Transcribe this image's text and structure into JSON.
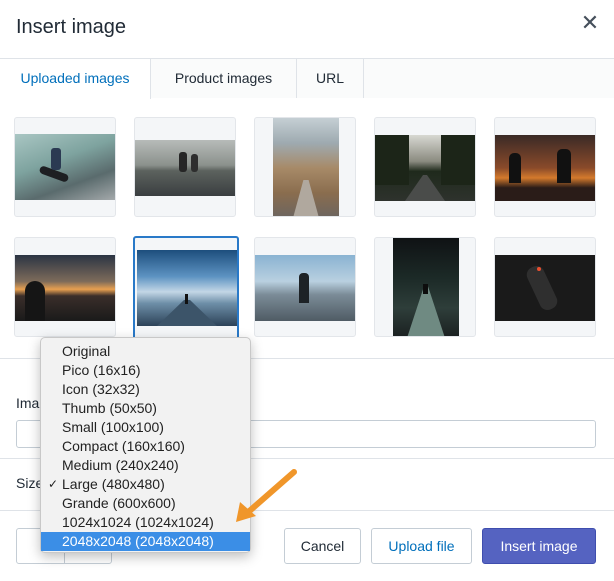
{
  "modal": {
    "title": "Insert image",
    "close_glyph": "✕"
  },
  "tabs": [
    {
      "label": "Uploaded images",
      "active": true
    },
    {
      "label": "Product images",
      "active": false
    },
    {
      "label": "URL",
      "active": false
    }
  ],
  "thumbnails": [
    {
      "subject": "skateboarder jumping",
      "selected": false
    },
    {
      "subject": "riders on road",
      "selected": false
    },
    {
      "subject": "mountain road",
      "selected": false
    },
    {
      "subject": "skater on forest road",
      "selected": false
    },
    {
      "subject": "silhouettes at sunset",
      "selected": false
    },
    {
      "subject": "skater under sunset sky",
      "selected": false
    },
    {
      "subject": "pier under cloudy sky",
      "selected": true
    },
    {
      "subject": "person facing mountains",
      "selected": false
    },
    {
      "subject": "night bridge",
      "selected": false
    },
    {
      "subject": "longboard on dark ground",
      "selected": false
    }
  ],
  "form": {
    "alt_label": "Imag",
    "size_label": "Size"
  },
  "size_options": [
    {
      "label": "Original",
      "checked": false,
      "highlighted": false
    },
    {
      "label": "Pico (16x16)",
      "checked": false,
      "highlighted": false
    },
    {
      "label": "Icon (32x32)",
      "checked": false,
      "highlighted": false
    },
    {
      "label": "Thumb (50x50)",
      "checked": false,
      "highlighted": false
    },
    {
      "label": "Small (100x100)",
      "checked": false,
      "highlighted": false
    },
    {
      "label": "Compact (160x160)",
      "checked": false,
      "highlighted": false
    },
    {
      "label": "Medium (240x240)",
      "checked": false,
      "highlighted": false
    },
    {
      "label": "Large (480x480)",
      "checked": true,
      "highlighted": false
    },
    {
      "label": "Grande (600x600)",
      "checked": false,
      "highlighted": false
    },
    {
      "label": "1024x1024 (1024x1024)",
      "checked": false,
      "highlighted": false
    },
    {
      "label": "2048x2048 (2048x2048)",
      "checked": false,
      "highlighted": true
    }
  ],
  "check_glyph": "✓",
  "footer": {
    "back_glyph": "←",
    "cancel_label": "Cancel",
    "upload_label": "Upload file",
    "insert_label": "Insert image"
  },
  "colors": {
    "accent": "#006fbb",
    "primary_button": "#5563c1",
    "highlight": "#3b8ee6",
    "annotation_arrow": "#f0962a"
  }
}
